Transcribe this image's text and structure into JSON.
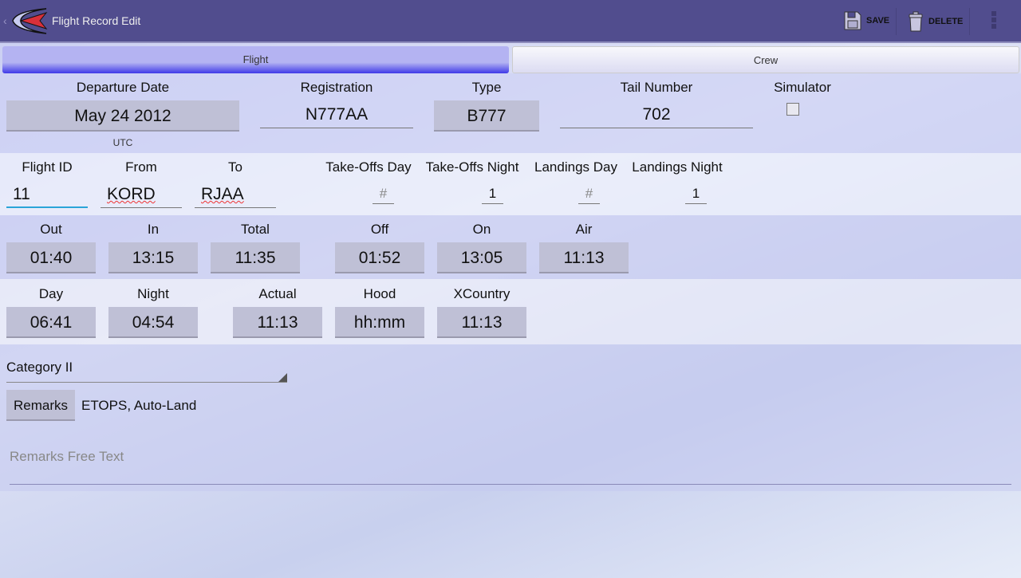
{
  "header": {
    "title": "Flight Record Edit",
    "save": "SAVE",
    "delete": "DELETE"
  },
  "tabs": [
    {
      "label": "Flight",
      "active": true
    },
    {
      "label": "Crew",
      "active": false
    }
  ],
  "row1": {
    "departure_date_label": "Departure Date",
    "departure_date": "May 24 2012",
    "utc": "UTC",
    "registration_label": "Registration",
    "registration": "N777AA",
    "type_label": "Type",
    "type": "B777",
    "tail_label": "Tail Number",
    "tail": "702",
    "simulator_label": "Simulator",
    "simulator_checked": false
  },
  "row2": {
    "flight_id_label": "Flight ID",
    "flight_id": "11",
    "from_label": "From",
    "from": "KORD",
    "to_label": "To",
    "to": "RJAA",
    "tod_label": "Take-Offs Day",
    "tod_placeholder": "#",
    "ton_label": "Take-Offs Night",
    "ton": "1",
    "ld_label": "Landings Day",
    "ld_placeholder": "#",
    "ln_label": "Landings Night",
    "ln": "1"
  },
  "row3": {
    "out_label": "Out",
    "out": "01:40",
    "in_label": "In",
    "in": "13:15",
    "total_label": "Total",
    "total": "11:35",
    "off_label": "Off",
    "off": "01:52",
    "on_label": "On",
    "on": "13:05",
    "air_label": "Air",
    "air": "11:13"
  },
  "row4": {
    "day_label": "Day",
    "day": "06:41",
    "night_label": "Night",
    "night": "04:54",
    "actual_label": "Actual",
    "actual": "11:13",
    "hood_label": "Hood",
    "hood": "hh:mm",
    "xc_label": "XCountry",
    "xc": "11:13"
  },
  "category": "Category II",
  "remarks": {
    "button": "Remarks",
    "value": "ETOPS, Auto-Land",
    "free_text_placeholder": "Remarks Free Text"
  }
}
